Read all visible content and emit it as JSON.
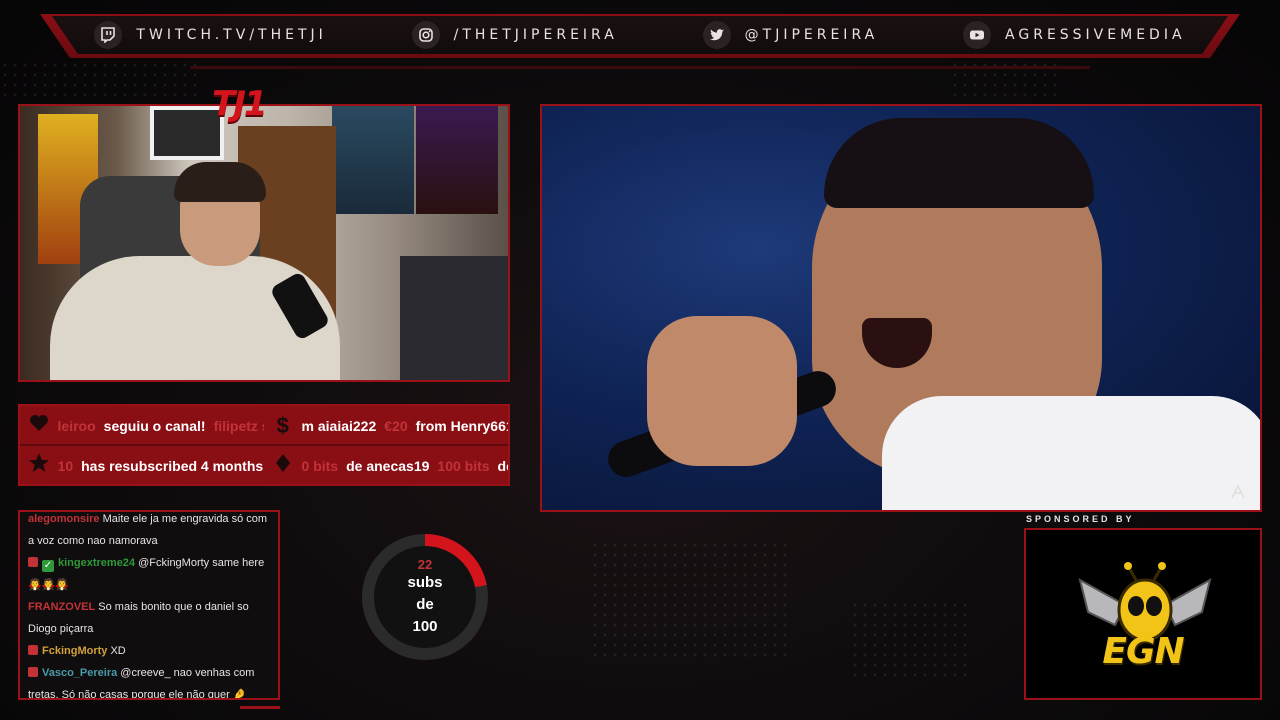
{
  "banner": {
    "links": [
      {
        "icon": "twitch-icon",
        "text": "TWITCH.TV/THETJI"
      },
      {
        "icon": "instagram-icon",
        "text": "/THETJIPEREIRA"
      },
      {
        "icon": "twitter-icon",
        "text": "@TJIPEREIRA"
      },
      {
        "icon": "youtube-icon",
        "text": "AGRESSIVEMEDIA"
      }
    ]
  },
  "logo": {
    "text": "TJ1"
  },
  "alerts": {
    "row1": {
      "follow_prev": "leiroo",
      "follow_msg": "seguiu o canal!",
      "follow_next": "filipetz s",
      "tip_name": "m aiaiai222",
      "tip_amount": "€20",
      "tip_from": "from Henry661"
    },
    "row2": {
      "resub_prev": "10",
      "resub_msg": "has resubscribed 4 months",
      "bits_prev": "0 bits",
      "bits_from": "de anecas19",
      "bits_amount": "100 bits",
      "bits_next": "de"
    }
  },
  "chat": {
    "messages": [
      {
        "user": "alegomonsire",
        "user_color": "#c23338",
        "text": "Maite ele ja me engravida só com a voz como nao namorava"
      },
      {
        "user": "kingextreme24",
        "user_color": "#2e9a3a",
        "text": "@FckingMorty same here",
        "emotes": "🧛🧛🧛"
      },
      {
        "user": "FRANZOVEL",
        "user_color": "#c23338",
        "text": "So mais bonito que o daniel so Diogo piçarra"
      },
      {
        "user": "FckingMorty",
        "user_color": "#d1a13a",
        "text": "XD"
      },
      {
        "user": "Vasco_Pereira",
        "user_color": "#4a9aa8",
        "text": "@creeve_ nao venhas com tretas. Só não casas porque ele não quer 🤌"
      }
    ]
  },
  "goal": {
    "count": "22",
    "label1": "subs",
    "label2": "de",
    "label3": "100",
    "progress": 0.22
  },
  "sponsor": {
    "label": "SPONSORED BY",
    "brand": "EGN"
  },
  "colors": {
    "accent": "#8a0f15",
    "accent_bright": "#d4141c",
    "gold": "#f2c417"
  }
}
